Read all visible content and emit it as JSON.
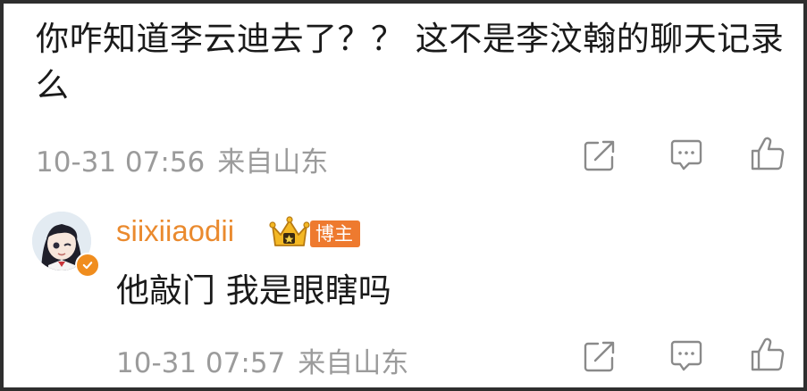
{
  "post": {
    "text": "你咋知道李云迪去了？？ 这不是李汶翰的聊天记录么",
    "time": "10-31 07:56",
    "source": "来自山东"
  },
  "reply": {
    "username": "siixiiaodii",
    "badge": "博主",
    "text": "他敲门 我是眼瞎吗",
    "time": "10-31 07:57",
    "source": "来自山东"
  },
  "icons": {
    "share": "share-icon",
    "comment": "comment-icon",
    "like": "like-icon",
    "crown": "crown-icon",
    "verified": "verified-icon"
  },
  "colors": {
    "accent": "#ea8a2e",
    "badge": "#ee7a2f",
    "meta": "#9b9b9b",
    "text": "#1a1a1a"
  }
}
